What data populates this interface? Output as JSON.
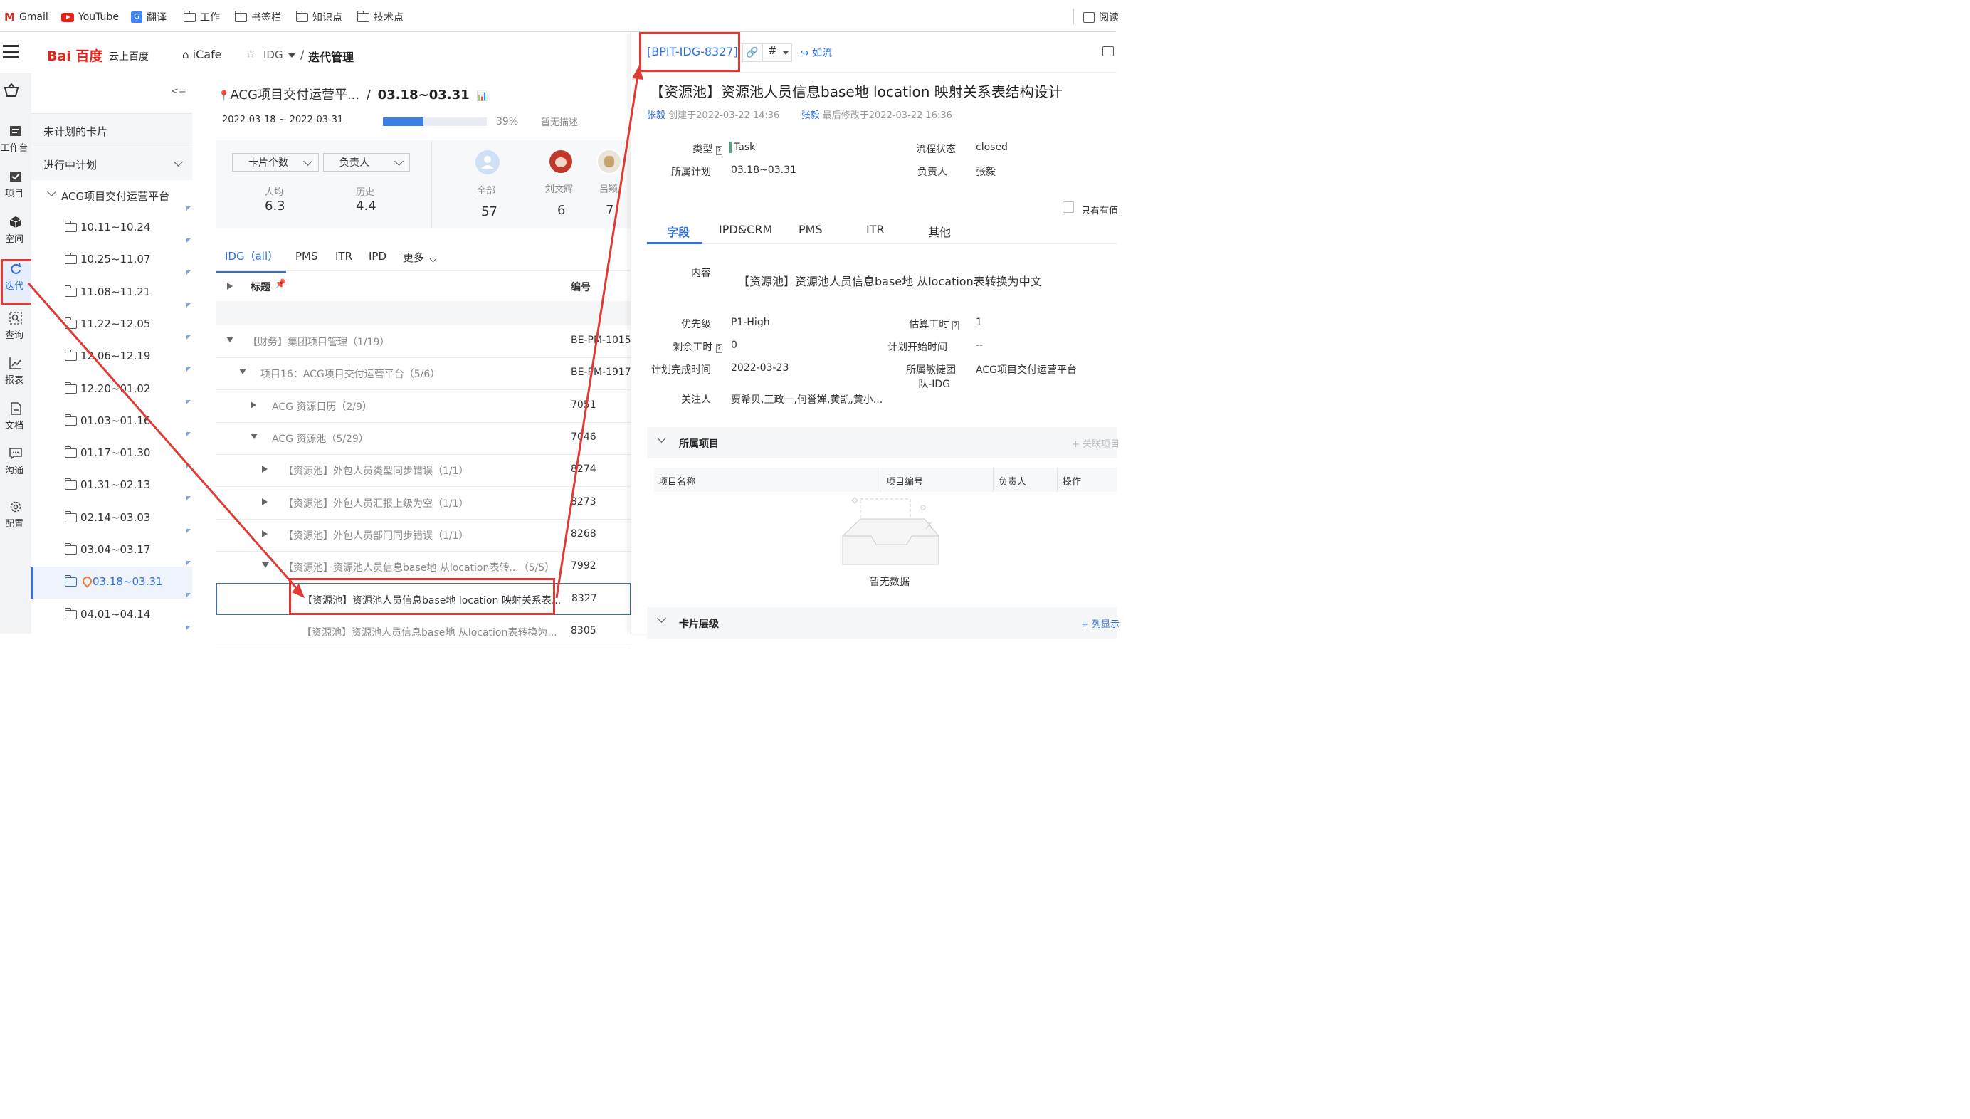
{
  "bookmarks": [
    {
      "label": "Gmail",
      "icon": "gmail-icon"
    },
    {
      "label": "YouTube",
      "icon": "youtube-icon"
    },
    {
      "label": "翻译",
      "icon": "google-translate-icon"
    },
    {
      "label": "工作",
      "icon": "folder-icon"
    },
    {
      "label": "书签栏",
      "icon": "folder-icon"
    },
    {
      "label": "知识点",
      "icon": "folder-icon"
    },
    {
      "label": "技术点",
      "icon": "folder-icon"
    }
  ],
  "bookmarks_right": "阅读",
  "header": {
    "logo_text": "Bai 百度",
    "logo_sub": "云上百度",
    "icafe": "iCafe",
    "space": "IDG",
    "sep": "/",
    "page": "迭代管理"
  },
  "rail": [
    {
      "label": "工作台",
      "icon": "workbench-icon"
    },
    {
      "label": "项目",
      "icon": "project-icon"
    },
    {
      "label": "空间",
      "icon": "cube-icon"
    },
    {
      "label": "迭代",
      "icon": "iteration-icon"
    },
    {
      "label": "查询",
      "icon": "query-icon"
    },
    {
      "label": "报表",
      "icon": "chart-icon"
    },
    {
      "label": "文档",
      "icon": "document-icon"
    },
    {
      "label": "沟通",
      "icon": "chat-icon"
    },
    {
      "label": "配置",
      "icon": "settings-icon"
    }
  ],
  "plans": {
    "collapse": "<=",
    "unplanned": "未计划的卡片",
    "in_progress": "进行中计划",
    "group": "ACG项目交付运营平台",
    "items": [
      "10.11~10.24",
      "10.25~11.07",
      "11.08~11.21",
      "11.22~12.05",
      "12.06~12.19",
      "12.20~01.02",
      "01.03~01.16",
      "01.17~01.30",
      "01.31~02.13",
      "02.14~03.03",
      "03.04~03.17",
      "03.18~03.31",
      "04.01~04.14"
    ],
    "active": "03.18~03.31"
  },
  "main": {
    "title_project": "ACG项目交付运营平...",
    "title_sep": "/",
    "title_plan": "03.18~03.31",
    "date_range": "2022-03-18 ~ 2022-03-31",
    "progress": 39,
    "progress_text": "39%",
    "no_desc": "暂无描述",
    "select1": "卡片个数",
    "select2": "负责人",
    "stat_avg_label": "人均",
    "stat_avg": "6.3",
    "stat_hist_label": "历史",
    "stat_hist": "4.4",
    "people": [
      {
        "name": "全部",
        "count": "57"
      },
      {
        "name": "刘文辉",
        "count": "6"
      },
      {
        "name": "吕颖",
        "count": "7"
      }
    ],
    "tabs": [
      "IDG（all）",
      "PMS",
      "ITR",
      "IPD",
      "更多"
    ],
    "col_title": "标题",
    "col_num": "编号",
    "rows": [
      {
        "title": "【财务】集团项目管理（1/19）",
        "num": "BE-PM-1015",
        "level": 0,
        "open": true
      },
      {
        "title": "项目16：ACG项目交付运营平台（5/6）",
        "num": "BE-PM-1917",
        "level": 1,
        "open": true
      },
      {
        "title": "ACG 资源日历（2/9）",
        "num": "7051",
        "level": 2,
        "open": false
      },
      {
        "title": "ACG 资源池（5/29）",
        "num": "7046",
        "level": 2,
        "open": true
      },
      {
        "title": "【资源池】外包人员类型同步错误（1/1）",
        "num": "8274",
        "level": 3,
        "open": false
      },
      {
        "title": "【资源池】外包人员汇报上级为空（1/1）",
        "num": "8273",
        "level": 3,
        "open": false
      },
      {
        "title": "【资源池】外包人员部门同步错误（1/1）",
        "num": "8268",
        "level": 3,
        "open": false
      },
      {
        "title": "【资源池】资源池人员信息base地 从location表转...（5/5）",
        "num": "7992",
        "level": 3,
        "open": true
      },
      {
        "title": "【资源池】资源池人员信息base地 location 映射关系表...",
        "num": "8327",
        "level": 4,
        "open": false,
        "selected": true
      },
      {
        "title": "【资源池】资源池人员信息base地 从location表转换为...",
        "num": "8305",
        "level": 4,
        "open": false
      }
    ]
  },
  "panel": {
    "id": "[BPIT-IDG-8327]",
    "flow": "如流",
    "title": "【资源池】资源池人员信息base地 location 映射关系表结构设计",
    "creator": "张毅",
    "created": "创建于2022-03-22 14:36",
    "modifier": "张毅",
    "modified": "最后修改于2022-03-22 16:36",
    "type_label": "类型",
    "type_val": "Task",
    "status_label": "流程状态",
    "status_val": "closed",
    "plan_label": "所属计划",
    "plan_val": "03.18~03.31",
    "owner_label": "负责人",
    "owner_val": "张毅",
    "only_see": "只看有值",
    "tabs": [
      "字段",
      "IPD&CRM",
      "PMS",
      "ITR",
      "其他"
    ],
    "content_label": "内容",
    "content_val": "【资源池】资源池人员信息base地  从location表转换为中文",
    "priority_label": "优先级",
    "priority_val": "P1-High",
    "est_label": "估算工时",
    "est_val": "1",
    "remain_label": "剩余工时",
    "remain_val": "0",
    "plan_start_label": "计划开始时间",
    "plan_start_val": "--",
    "plan_end_label": "计划完成时间",
    "plan_end_val": "2022-03-23",
    "team_label1": "所属敏捷团",
    "team_label2": "队-IDG",
    "team_val": "ACG项目交付运营平台",
    "watch_label": "关注人",
    "watch_val": "贾希贝,王政一,何誉婵,黄凯,黄小...",
    "section1": "所属项目",
    "link_project": "+ 关联项目",
    "cols": [
      "项目名称",
      "项目编号",
      "负责人",
      "操作"
    ],
    "empty": "暂无数据",
    "section2": "卡片层级",
    "show_more": "+ 列显示"
  }
}
